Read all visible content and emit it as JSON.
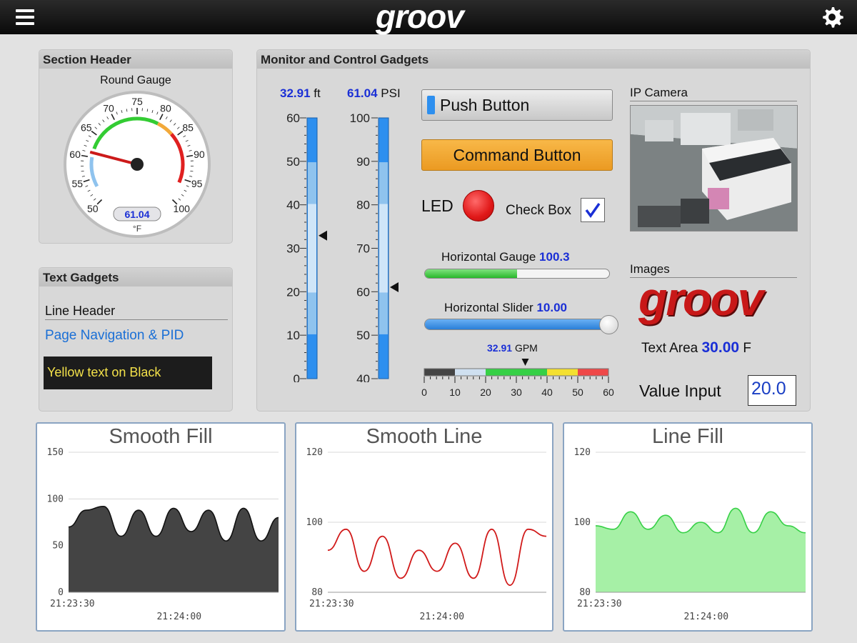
{
  "app": {
    "title": "groov"
  },
  "section_header": {
    "title": "Section Header",
    "gauge_label": "Round Gauge",
    "value": 61.04,
    "value_text": "61.04",
    "unit": "°F",
    "ticks": [
      "50",
      "55",
      "60",
      "65",
      "70",
      "75",
      "80",
      "85",
      "90",
      "95",
      "100"
    ]
  },
  "text_gadgets": {
    "title": "Text Gadgets",
    "line_header": "Line Header",
    "link": "Page Navigation & PID",
    "yellow_text": "Yellow text on Black"
  },
  "monitor": {
    "title": "Monitor and Control Gadgets",
    "tank1": {
      "value_text": "32.91",
      "unit": "ft",
      "value": 32.91,
      "min": 0,
      "max": 60,
      "ticks": [
        "60",
        "50",
        "40",
        "30",
        "20",
        "10",
        "0"
      ]
    },
    "tank2": {
      "value_text": "61.04",
      "unit": "PSI",
      "value": 61.04,
      "min": 40,
      "max": 100,
      "ticks": [
        "100",
        "90",
        "80",
        "70",
        "60",
        "50",
        "40"
      ]
    },
    "push_button": "Push Button",
    "command_button": "Command Button",
    "led_label": "LED",
    "checkbox_label": "Check Box",
    "hgauge_label": "Horizontal Gauge",
    "hgauge_value": "100.3",
    "hgauge_fill": 0.5,
    "hslider_label": "Horizontal Slider",
    "hslider_value": "10.00",
    "hslider_fill": 1.0,
    "gpm_value": "32.91",
    "gpm_unit": "GPM",
    "gpm_ticks": [
      "0",
      "10",
      "20",
      "30",
      "40",
      "50",
      "60"
    ],
    "ip_camera": "IP Camera",
    "images": "Images",
    "images_logo": "groov",
    "text_area_label": "Text Area",
    "text_area_value": "30.00",
    "text_area_unit": "F",
    "value_input_label": "Value Input",
    "value_input": "20.0"
  },
  "colors": {
    "blue_value": "#1a2fd6",
    "accent_orange": "#f2a93a",
    "led_red": "#e01818",
    "yellow_text": "#f4e24a"
  },
  "icons": {
    "menu": "hamburger-icon",
    "settings": "gear-icon"
  },
  "chart_data": [
    {
      "type": "area",
      "title": "Smooth Fill",
      "yticks": [
        "150",
        "100",
        "50",
        "0"
      ],
      "ylim": [
        0,
        150
      ],
      "xticks": [
        "21:23:30",
        "21:24:00"
      ],
      "x": [
        "21:23:30",
        "21:23:35",
        "21:23:40",
        "21:23:45",
        "21:23:50",
        "21:23:55",
        "21:24:00",
        "21:24:05",
        "21:24:10",
        "21:24:15",
        "21:24:20",
        "21:24:25",
        "21:24:30"
      ],
      "series": [
        {
          "values": [
            70,
            88,
            92,
            60,
            88,
            60,
            90,
            65,
            88,
            55,
            90,
            55,
            80
          ]
        }
      ],
      "color": "#444444"
    },
    {
      "type": "line",
      "title": "Smooth Line",
      "yticks": [
        "120",
        "100",
        "80"
      ],
      "ylim": [
        80,
        120
      ],
      "xticks": [
        "21:23:30",
        "21:24:00"
      ],
      "x": [
        "21:23:30",
        "21:23:35",
        "21:23:40",
        "21:23:45",
        "21:23:50",
        "21:23:55",
        "21:24:00",
        "21:24:05",
        "21:24:10",
        "21:24:15",
        "21:24:20",
        "21:24:25",
        "21:24:30"
      ],
      "series": [
        {
          "values": [
            92,
            98,
            86,
            96,
            84,
            92,
            86,
            94,
            84,
            98,
            82,
            98,
            96
          ]
        }
      ],
      "color": "#d11a1a"
    },
    {
      "type": "area",
      "title": "Line Fill",
      "yticks": [
        "120",
        "100",
        "80"
      ],
      "ylim": [
        80,
        120
      ],
      "xticks": [
        "21:23:30",
        "21:24:00"
      ],
      "x": [
        "21:23:30",
        "21:23:35",
        "21:23:40",
        "21:23:45",
        "21:23:50",
        "21:23:55",
        "21:24:00",
        "21:24:05",
        "21:24:10",
        "21:24:15",
        "21:24:20",
        "21:24:25",
        "21:24:30"
      ],
      "series": [
        {
          "values": [
            99,
            98,
            103,
            98,
            102,
            97,
            100,
            97,
            104,
            97,
            103,
            99,
            97
          ]
        }
      ],
      "color": "#36d046"
    }
  ]
}
